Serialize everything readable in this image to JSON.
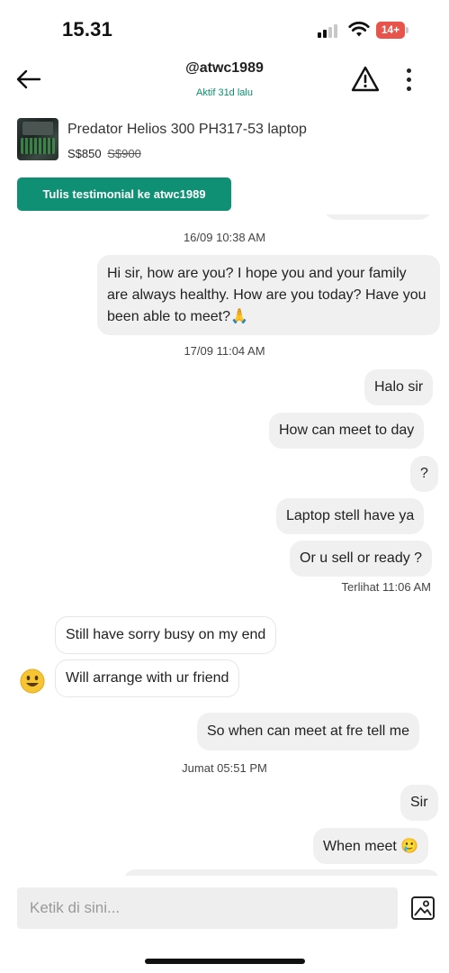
{
  "status_bar": {
    "time": "15.31",
    "battery": "14+"
  },
  "header": {
    "username": "@atwc1989",
    "status": "Aktif 31d lalu",
    "back_icon": "arrow-left-icon",
    "report_icon": "warning-triangle-icon",
    "more_icon": "vertical-dots-icon"
  },
  "listing": {
    "title": "Predator Helios 300 PH317-53 laptop",
    "price": "S$850",
    "original_price": "S$900"
  },
  "testimonial_button": "Tulis testimonial ke atwc1989",
  "messages": {
    "ts1": "16/09 10:38 AM",
    "m1": "Hi sir, how are you? I hope you and your family are always healthy. How are you today? Have you been able to meet?🙏",
    "ts2": "17/09 11:04 AM",
    "m2": "Halo sir",
    "m3": "How can meet to day",
    "m4": "?",
    "m5": "Laptop stell have ya",
    "m6": "Or u sell or ready ?",
    "seen": "Terlihat 11:06 AM",
    "m7": "Still have sorry busy on my end",
    "m8": "Will arrange with ur friend",
    "m9": "So when can meet at fre tell me",
    "ts3": "Jumat 05:51 PM",
    "m10": "Sir",
    "m11": "When meet 🥲"
  },
  "input": {
    "placeholder": "Ketik di sini..."
  },
  "colors": {
    "accent": "#0f8f74",
    "status_green": "#0a8f6c",
    "bubble": "#f0f0f0",
    "battery_low": "#e8534b"
  }
}
